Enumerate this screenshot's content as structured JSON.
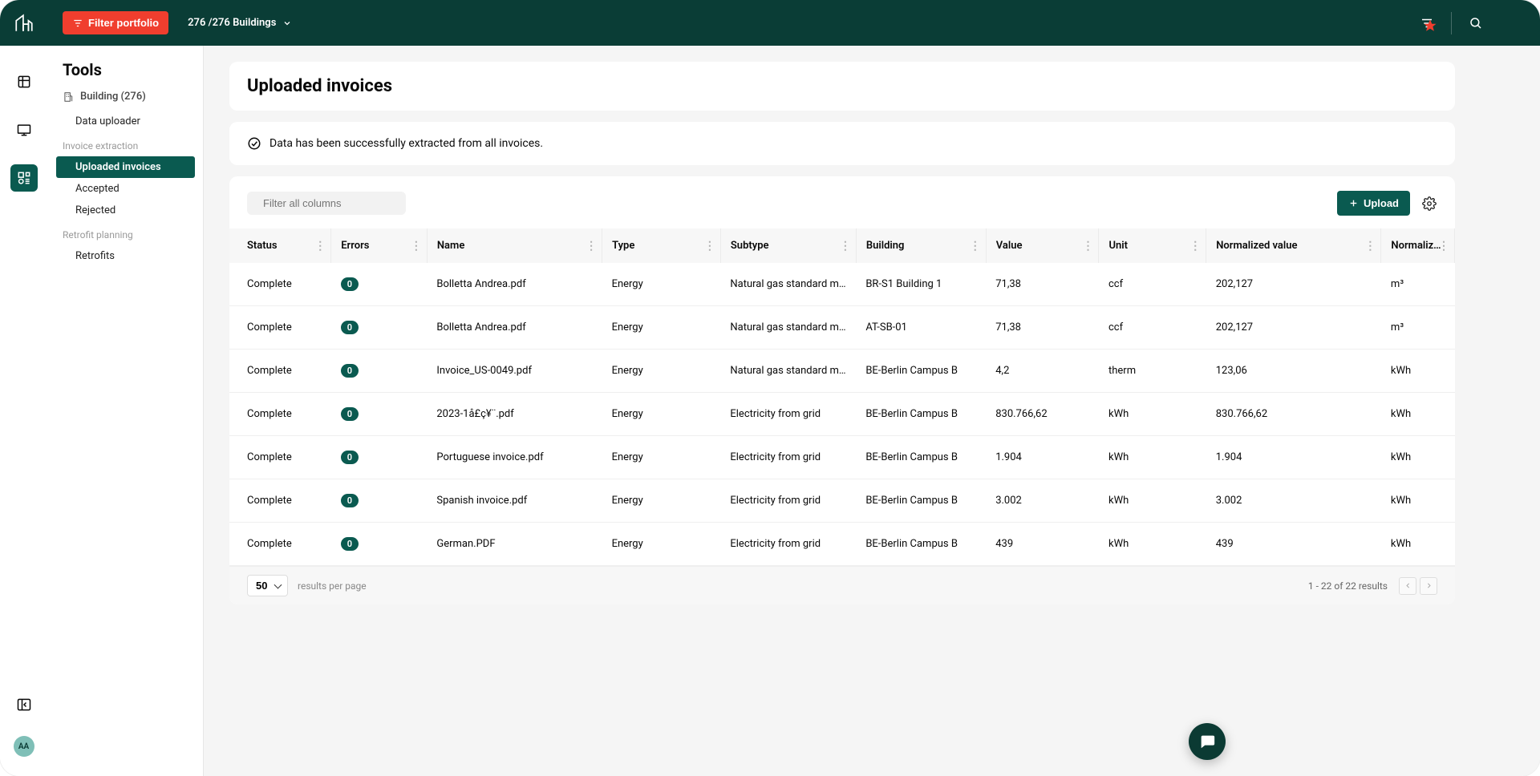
{
  "topbar": {
    "filter_btn": "Filter portfolio",
    "portfolio_label": "276 /276 Buildings"
  },
  "sidebar": {
    "title": "Tools",
    "building_group": "Building (276)",
    "items": {
      "data_uploader": "Data uploader",
      "invoice_extraction_label": "Invoice extraction",
      "uploaded_invoices": "Uploaded invoices",
      "accepted": "Accepted",
      "rejected": "Rejected",
      "retrofit_planning_label": "Retrofit planning",
      "retrofits": "Retrofits"
    }
  },
  "avatar_initials": "AA",
  "page": {
    "title": "Uploaded invoices",
    "extraction_message": "Data has been successfully extracted from all invoices."
  },
  "toolbar": {
    "filter_placeholder": "Filter all columns",
    "upload_label": "Upload"
  },
  "table": {
    "columns": [
      "Status",
      "Errors",
      "Name",
      "Type",
      "Subtype",
      "Building",
      "Value",
      "Unit",
      "Normalized value",
      "Normalized unit"
    ],
    "rows": [
      {
        "status": "Complete",
        "errors": "0",
        "name": "Bolletta Andrea.pdf",
        "type": "Energy",
        "subtype": "Natural gas standard mix",
        "building": "BR-S1 Building 1",
        "value": "71,38",
        "unit": "ccf",
        "norm_value": "202,127",
        "norm_unit": "m³"
      },
      {
        "status": "Complete",
        "errors": "0",
        "name": "Bolletta Andrea.pdf",
        "type": "Energy",
        "subtype": "Natural gas standard mix",
        "building": "AT-SB-01",
        "value": "71,38",
        "unit": "ccf",
        "norm_value": "202,127",
        "norm_unit": "m³"
      },
      {
        "status": "Complete",
        "errors": "0",
        "name": "Invoice_US-0049.pdf",
        "type": "Energy",
        "subtype": "Natural gas standard mix",
        "building": "BE-Berlin Campus B",
        "value": "4,2",
        "unit": "therm",
        "norm_value": "123,06",
        "norm_unit": "kWh"
      },
      {
        "status": "Complete",
        "errors": "0",
        "name": "2023-1å­£ç¥¨.pdf",
        "type": "Energy",
        "subtype": "Electricity from grid",
        "building": "BE-Berlin Campus B",
        "value": "830.766,62",
        "unit": "kWh",
        "norm_value": "830.766,62",
        "norm_unit": "kWh"
      },
      {
        "status": "Complete",
        "errors": "0",
        "name": "Portuguese invoice.pdf",
        "type": "Energy",
        "subtype": "Electricity from grid",
        "building": "BE-Berlin Campus B",
        "value": "1.904",
        "unit": "kWh",
        "norm_value": "1.904",
        "norm_unit": "kWh"
      },
      {
        "status": "Complete",
        "errors": "0",
        "name": "Spanish invoice.pdf",
        "type": "Energy",
        "subtype": "Electricity from grid",
        "building": "BE-Berlin Campus B",
        "value": "3.002",
        "unit": "kWh",
        "norm_value": "3.002",
        "norm_unit": "kWh"
      },
      {
        "status": "Complete",
        "errors": "0",
        "name": "German.PDF",
        "type": "Energy",
        "subtype": "Electricity from grid",
        "building": "BE-Berlin Campus B",
        "value": "439",
        "unit": "kWh",
        "norm_value": "439",
        "norm_unit": "kWh"
      }
    ]
  },
  "footer": {
    "rpp": "50",
    "rpp_label": "results per page",
    "count": "1 - 22 of 22 results"
  }
}
